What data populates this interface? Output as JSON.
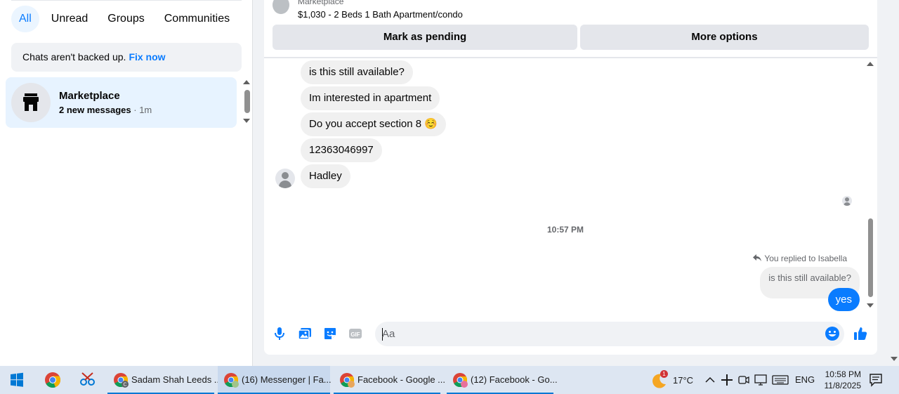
{
  "sidebar": {
    "filters": [
      {
        "label": "All",
        "active": true
      },
      {
        "label": "Unread",
        "active": false
      },
      {
        "label": "Groups",
        "active": false
      },
      {
        "label": "Communities",
        "active": false
      }
    ],
    "backup_notice": {
      "text": "Chats aren't backed up.",
      "link": "Fix now"
    },
    "conversations": [
      {
        "title": "Marketplace",
        "subtitle": "2 new messages",
        "time": "1m",
        "icon": "store-icon"
      }
    ]
  },
  "chat": {
    "listing": {
      "source": "Marketplace",
      "title": "$1,030 - 2 Beds 1 Bath Apartment/condo"
    },
    "actions": {
      "pending": "Mark as pending",
      "more": "More options"
    },
    "incoming_messages": [
      "is this still available?",
      "Im interested in apartment",
      "Do you accept section 8",
      "12363046997",
      "Hadley"
    ],
    "incoming_emoji": "☺️",
    "timestamp": "10:57 PM",
    "reply_note": "You replied to Isabella",
    "quoted_message": "is this still available?",
    "outgoing_message": "yes",
    "composer": {
      "placeholder": "Aa"
    },
    "colors": {
      "accent": "#0a7cff",
      "bubble": "#f0f0f0"
    }
  },
  "taskbar": {
    "apps": [
      {
        "label": "Sadam Shah Leeds ...",
        "badge": "C",
        "active": false
      },
      {
        "label": "(16) Messenger | Fa...",
        "badge": "",
        "active": true
      },
      {
        "label": "Facebook - Google ...",
        "badge": "",
        "active": false
      },
      {
        "label": "(12) Facebook - Go...",
        "badge": "",
        "active": false
      }
    ],
    "weather": {
      "temp": "17°C",
      "badge": "1"
    },
    "language": "ENG",
    "clock": {
      "time": "10:58 PM",
      "date": "11/8/2025"
    }
  }
}
